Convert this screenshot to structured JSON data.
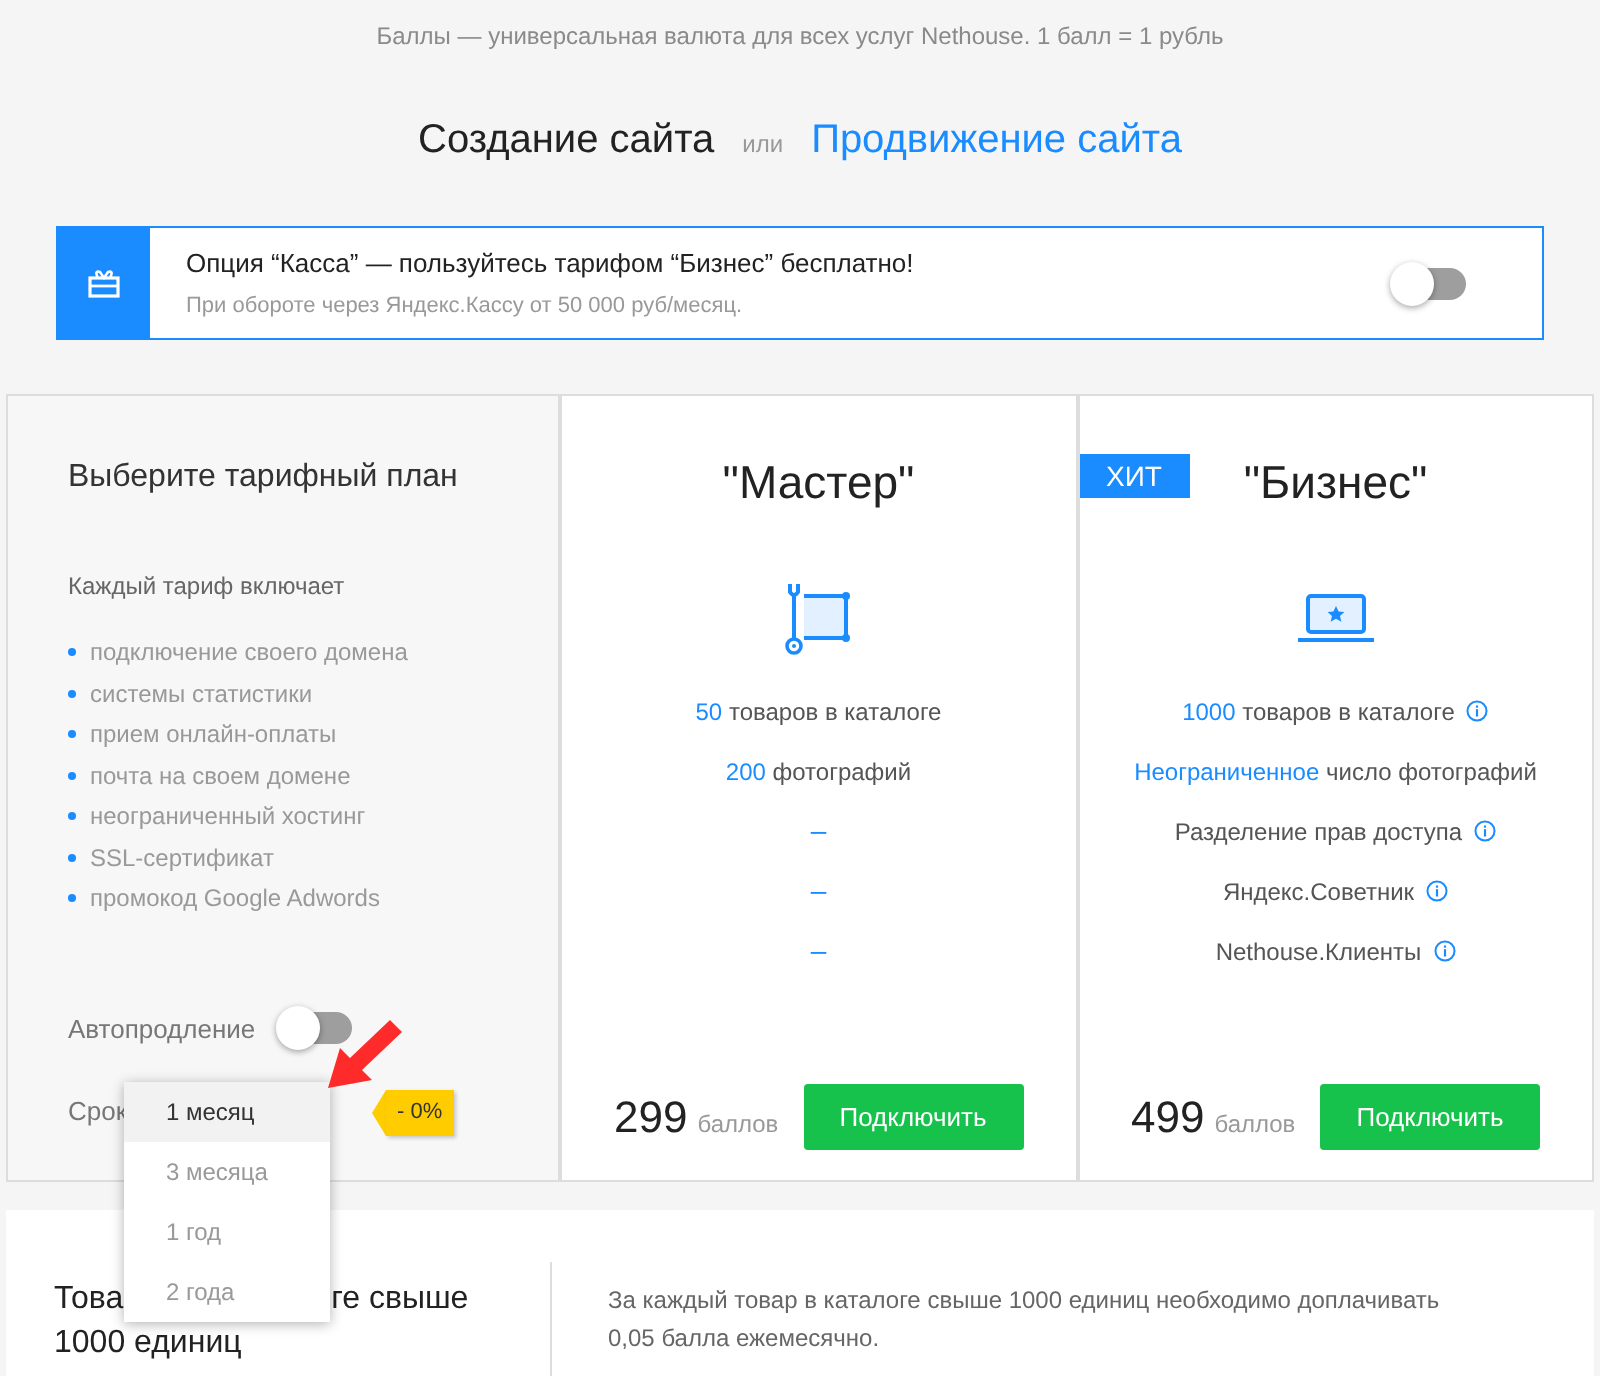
{
  "info_line": "Баллы — универсальная валюта для всех услуг Nethouse. 1 балл = 1 рубль",
  "heading": {
    "primary": "Создание сайта",
    "separator": "или",
    "link": "Продвижение сайта"
  },
  "promo": {
    "title": "Опция “Касса” — пользуйтесь тарифом “Бизнес” бесплатно!",
    "subtitle": "При обороте через Яндекс.Кассу от 50 000 руб/месяц.",
    "on": false
  },
  "plan_intro": {
    "title": "Выберите тарифный план",
    "includes_label": "Каждый тариф включает",
    "features": [
      "подключение своего домена",
      "системы статистики",
      "прием онлайн-оплаты",
      "почта на своем домене",
      "неограниченный хостинг",
      "SSL-сертификат",
      "промокод Google Adwords"
    ],
    "autorenew": {
      "label": "Автопродление",
      "on": false
    },
    "term": {
      "label": "Срок",
      "discount": "- 0%"
    }
  },
  "plans": [
    {
      "name": "\"Мастер\"",
      "features": [
        {
          "kind": "text",
          "highlight": "50",
          "text": "товаров в каталоге",
          "info": false
        },
        {
          "kind": "text",
          "highlight": "200",
          "text": "фотографий",
          "info": false
        },
        {
          "kind": "dash",
          "text": "–"
        },
        {
          "kind": "dash",
          "text": "–"
        },
        {
          "kind": "dash",
          "text": "–"
        }
      ],
      "price": "299",
      "unit": "баллов",
      "button": "Подключить"
    },
    {
      "name": "\"Бизнес\"",
      "badge": "ХИТ",
      "features": [
        {
          "kind": "text",
          "highlight": "1000",
          "text": "товаров в каталоге",
          "info": true
        },
        {
          "kind": "text",
          "highlight": "Неограниченное",
          "text": "число фотографий",
          "info": false
        },
        {
          "kind": "text",
          "text": "Разделение прав доступа",
          "info": true
        },
        {
          "kind": "text",
          "text": "Яндекс.Советник",
          "info": true
        },
        {
          "kind": "text",
          "text": "Nethouse.Клиенты",
          "info": true
        }
      ],
      "price": "499",
      "unit": "баллов",
      "button": "Подключить"
    }
  ],
  "dropdown": {
    "options": [
      {
        "label": "1 месяц",
        "selected": true
      },
      {
        "label": "3 месяца",
        "selected": false
      },
      {
        "label": "1 год",
        "selected": false
      },
      {
        "label": "2 года",
        "selected": false
      }
    ]
  },
  "extra": {
    "heading_parts": [
      "Това",
      "ге свыше"
    ],
    "heading_line2": "1000 единиц",
    "text": "За каждый товар в каталоге свыше 1000 единиц необходимо доплачивать 0,05 балла ежемесячно."
  }
}
